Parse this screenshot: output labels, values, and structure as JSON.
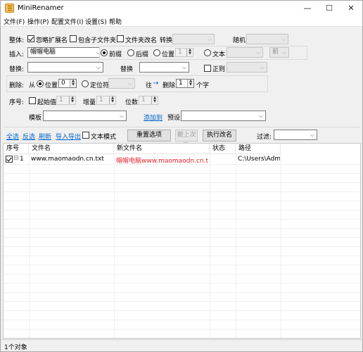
{
  "window": {
    "title": "MiniRenamer",
    "minimize": "—",
    "maximize": "☐",
    "close": "✕"
  },
  "menu": [
    "文件(F)",
    "操作(P)",
    "配置文件(I)",
    "设置(S)",
    "帮助"
  ],
  "overall": {
    "label": "整体:",
    "ignore_ext": "忽略扩展名",
    "ignore_ext_checked": true,
    "include_subfolders": "包含子文件夹",
    "folder_rename": "文件夹改名",
    "convert_label": "转换",
    "random_label": "随机"
  },
  "insert": {
    "label": "插入:",
    "combo_value": "帽帽电脑",
    "prefix": "前缀",
    "suffix": "后缀",
    "position": "位置",
    "position_value": "1",
    "text": "文本",
    "front_value": "前"
  },
  "replace": {
    "label": "替换:",
    "with_label": "替换",
    "regex": "正则"
  },
  "delete": {
    "label": "删除:",
    "from": "从",
    "position": "位置",
    "position_value": "0",
    "locate_char": "定位符",
    "to": "往",
    "arrow": "→",
    "delete_label": "删除",
    "count_value": "1",
    "chars": "个字"
  },
  "serial": {
    "label": "序号:",
    "start": "起始值",
    "start_value": "1",
    "increment": "增量",
    "increment_value": "1",
    "digits": "位数",
    "digits_value": "1"
  },
  "template": {
    "label": "模板",
    "add_link": "添加到",
    "preset_label": "预设"
  },
  "actions": {
    "select_all": "全选",
    "invert": "反选",
    "refresh": "刷新",
    "import_export": "导入导出",
    "text_mode": "文本模式",
    "reset": "重置选项",
    "undo": "撤上次改",
    "execute": "执行改名",
    "filter": "过滤:"
  },
  "table": {
    "columns": [
      "序号",
      "文件名",
      "新文件名",
      "状态",
      "路径"
    ],
    "rows": [
      {
        "index": "1",
        "checked": true,
        "filename": "www.maomaodn.cn.txt",
        "new_filename": "帽帽电脑www.maomaodn.cn.txt",
        "status": "",
        "path": "C:\\Users\\Adm..."
      }
    ]
  },
  "status": {
    "text": "1个对象"
  },
  "colors": {
    "new_name": "#e4232b",
    "link": "#0066cc"
  }
}
